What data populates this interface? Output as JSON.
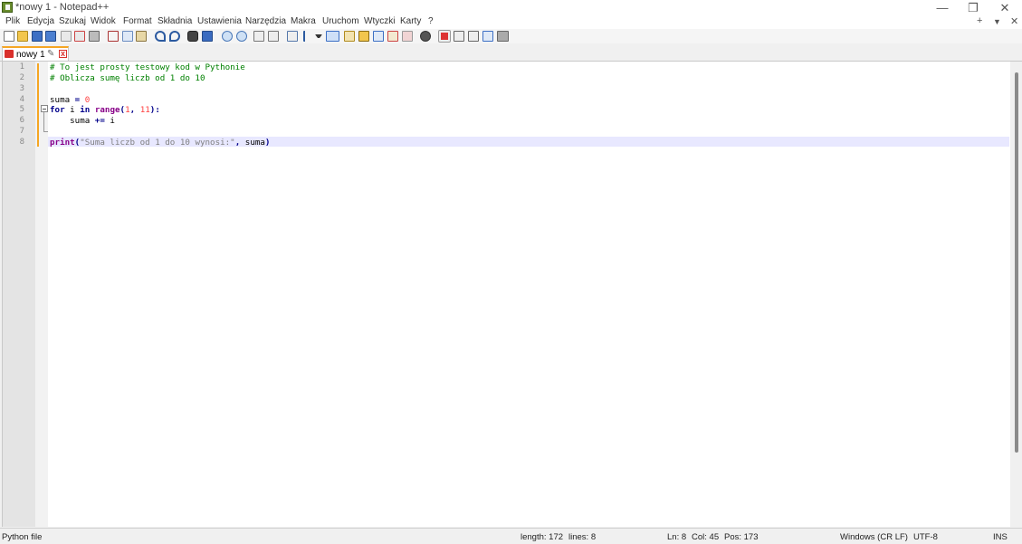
{
  "window": {
    "title": "*nowy 1 - Notepad++",
    "controls": {
      "minimize": "—",
      "restore": "❐",
      "close": "✕"
    }
  },
  "menu": {
    "items": [
      "Plik",
      "Edycja",
      "Szukaj",
      "Widok",
      "Format",
      "Składnia",
      "Ustawienia",
      "Narzędzia",
      "Makra",
      "Uruchom",
      "Wtyczki",
      "Karty",
      "?"
    ],
    "right": {
      "add": "+",
      "list": "▼",
      "close": "✕"
    }
  },
  "toolbar": {
    "icons": [
      "new-file-icon",
      "open-file-icon",
      "save-icon",
      "save-all-icon",
      "close-icon",
      "close-all-icon",
      "print-icon",
      "cut-icon",
      "copy-icon",
      "paste-icon",
      "undo-icon",
      "redo-icon",
      "find-icon",
      "replace-icon",
      "zoom-in-icon",
      "zoom-out-icon",
      "sync-v-icon",
      "sync-h-icon",
      "word-wrap-icon",
      "show-all-chars-icon",
      "dropdown-icon",
      "indent-guide-icon",
      "udl-icon",
      "doc-map-icon",
      "function-list-icon",
      "folder-workspace-icon",
      "monitoring-icon",
      "record-macro-icon",
      "stop-record-icon",
      "play-macro-icon",
      "run-macro-multiple-icon",
      "save-macro-icon"
    ]
  },
  "tabs": [
    {
      "label": "nowy 1",
      "pin": "✎",
      "close": "x"
    }
  ],
  "editor": {
    "line_numbers": [
      "1",
      "2",
      "3",
      "4",
      "5",
      "6",
      "7",
      "8"
    ],
    "lines": [
      [
        {
          "t": "cmt",
          "v": "# To jest prosty testowy kod w Pythonie"
        }
      ],
      [
        {
          "t": "cmt",
          "v": "# Oblicza sumę liczb od 1 do 10"
        }
      ],
      [],
      [
        {
          "t": "",
          "v": "suma "
        },
        {
          "t": "op",
          "v": "="
        },
        {
          "t": "",
          "v": " "
        },
        {
          "t": "num",
          "v": "0"
        }
      ],
      [
        {
          "t": "kw",
          "v": "for"
        },
        {
          "t": "",
          "v": " i "
        },
        {
          "t": "kw",
          "v": "in"
        },
        {
          "t": "",
          "v": " "
        },
        {
          "t": "bi",
          "v": "range"
        },
        {
          "t": "op",
          "v": "("
        },
        {
          "t": "num",
          "v": "1"
        },
        {
          "t": "op",
          "v": ","
        },
        {
          "t": "",
          "v": " "
        },
        {
          "t": "num",
          "v": "11"
        },
        {
          "t": "op",
          "v": "):"
        }
      ],
      [
        {
          "t": "",
          "v": "    suma "
        },
        {
          "t": "op",
          "v": "+="
        },
        {
          "t": "",
          "v": " i"
        }
      ],
      [],
      [
        {
          "t": "bi",
          "v": "print"
        },
        {
          "t": "op",
          "v": "("
        },
        {
          "t": "str",
          "v": "\"Suma liczb od 1 do 10 wynosi:\""
        },
        {
          "t": "op",
          "v": ","
        },
        {
          "t": "",
          "v": " suma"
        },
        {
          "t": "op",
          "v": ")"
        }
      ]
    ]
  },
  "status": {
    "file_type": "Python file",
    "length": "length: 172",
    "lines": "lines: 8",
    "ln": "Ln: 8",
    "col": "Col: 45",
    "pos": "Pos: 173",
    "eol": "Windows (CR LF)",
    "encoding": "UTF-8",
    "mode": "INS"
  }
}
